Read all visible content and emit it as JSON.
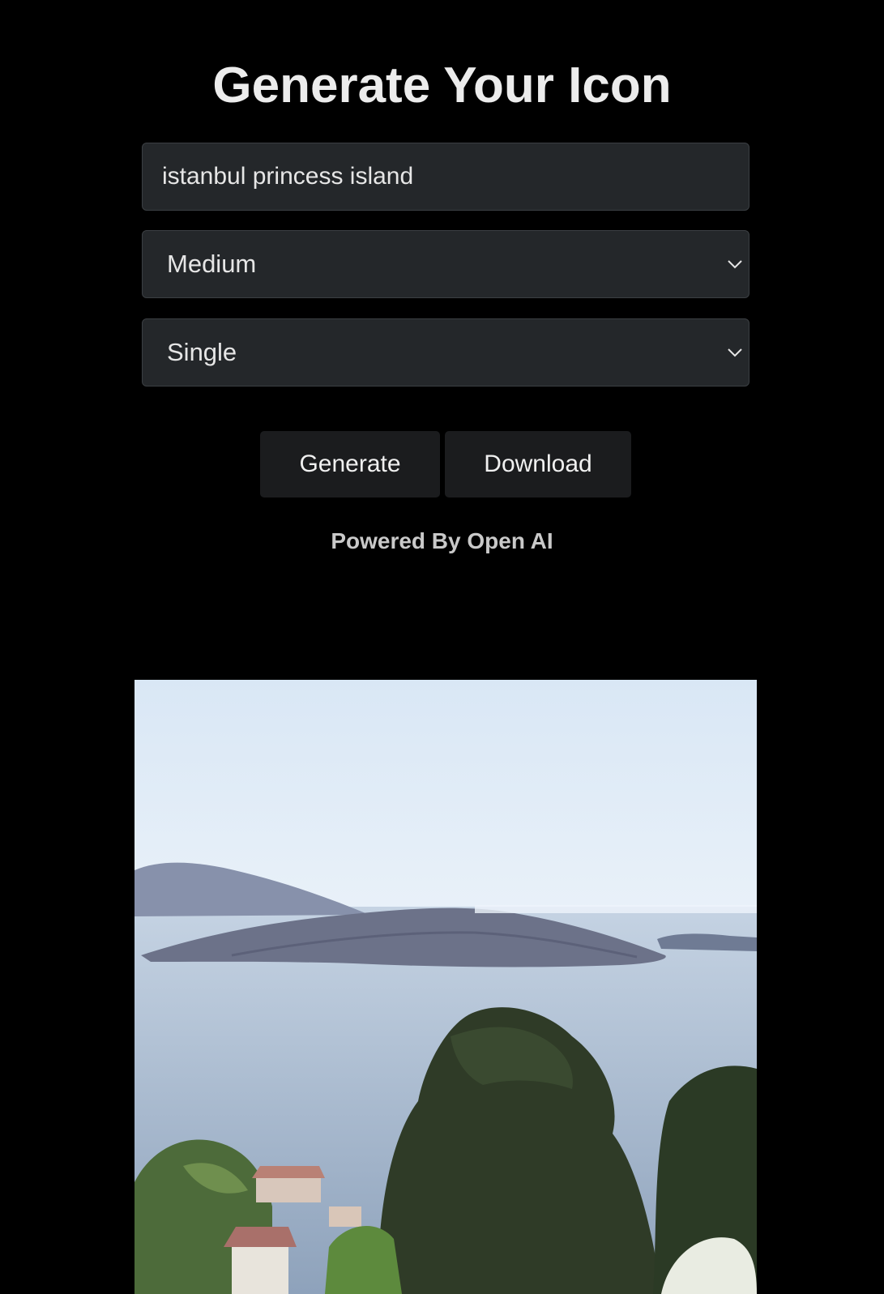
{
  "header": {
    "title": "Generate Your Icon"
  },
  "form": {
    "prompt_value": "istanbul princess island",
    "quality_selected": "Medium",
    "count_selected": "Single"
  },
  "actions": {
    "generate_label": "Generate",
    "download_label": "Download"
  },
  "footer": {
    "powered_text": "Powered By Open AI"
  },
  "icons": {
    "select_arrow": "chevron-down-icon"
  },
  "colors": {
    "background": "#000000",
    "field_background": "#24272a",
    "button_background": "#1b1c1e",
    "text": "#ececec"
  }
}
